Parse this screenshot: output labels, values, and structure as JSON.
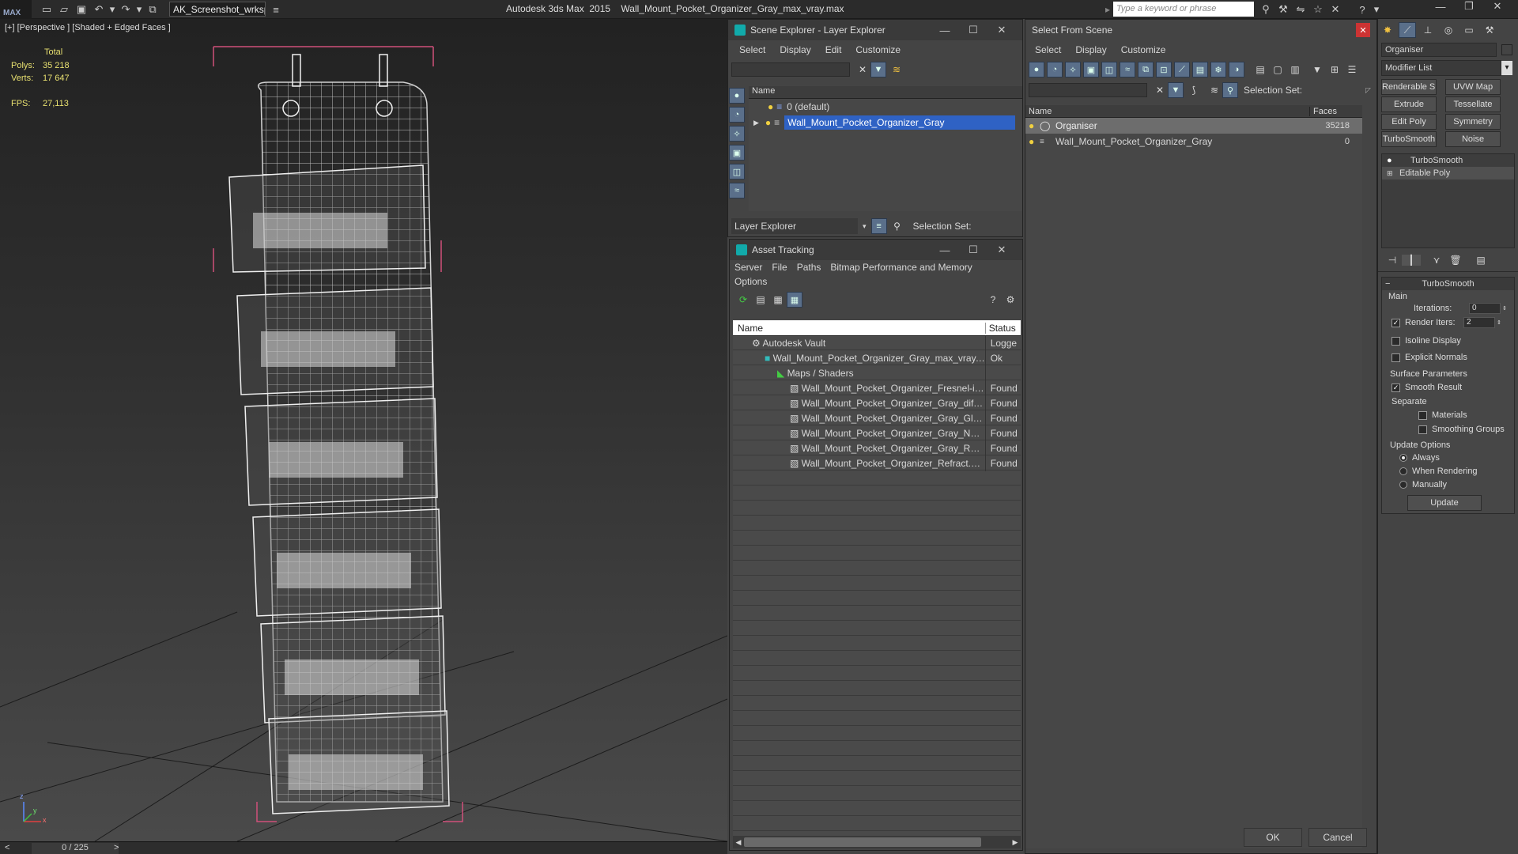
{
  "titlebar": {
    "logo": "MAX",
    "workspace": "AK_Screenshot_wrksp",
    "app_title": "Autodesk 3ds Max  2015    Wall_Mount_Pocket_Organizer_Gray_max_vray.max",
    "search_placeholder": "Type a keyword or phrase"
  },
  "viewport": {
    "label": "[+] [Perspective ] [Shaded + Edged Faces ]",
    "stats": {
      "total_label": "Total",
      "polys_label": "Polys:",
      "polys": "35 218",
      "verts_label": "Verts:",
      "verts": "17 647",
      "fps_label": "FPS:",
      "fps": "27,113"
    },
    "axis": {
      "z": "z",
      "x": "x",
      "y": "y"
    }
  },
  "timeline": {
    "frame": "0 / 225",
    "prev": "<",
    "next": ">"
  },
  "scene_explorer": {
    "title": "Scene Explorer - Layer Explorer",
    "menu": [
      "Select",
      "Display",
      "Edit",
      "Customize"
    ],
    "col_name": "Name",
    "rows": [
      {
        "label": "0 (default)",
        "selected": false
      },
      {
        "label": "Wall_Mount_Pocket_Organizer_Gray",
        "selected": true
      }
    ],
    "footer_select": "Layer Explorer",
    "footer_selset": "Selection Set:"
  },
  "asset_tracking": {
    "title": "Asset Tracking",
    "menu": [
      "Server",
      "File",
      "Paths",
      "Bitmap Performance and Memory"
    ],
    "menu2": "Options",
    "col_name": "Name",
    "col_status": "Status",
    "rows": [
      {
        "indent": 0,
        "name": "Autodesk Vault",
        "status": "Logge"
      },
      {
        "indent": 1,
        "name": "Wall_Mount_Pocket_Organizer_Gray_max_vray....",
        "status": "Ok"
      },
      {
        "indent": 2,
        "name": "Maps / Shaders",
        "status": ""
      },
      {
        "indent": 3,
        "name": "Wall_Mount_Pocket_Organizer_Fresnel-ior....",
        "status": "Found"
      },
      {
        "indent": 3,
        "name": "Wall_Mount_Pocket_Organizer_Gray_diffus...",
        "status": "Found"
      },
      {
        "indent": 3,
        "name": "Wall_Mount_Pocket_Organizer_Gray_Gloss...",
        "status": "Found"
      },
      {
        "indent": 3,
        "name": "Wall_Mount_Pocket_Organizer_Gray_Nor...",
        "status": "Found"
      },
      {
        "indent": 3,
        "name": "Wall_Mount_Pocket_Organizer_Gray_Refle...",
        "status": "Found"
      },
      {
        "indent": 3,
        "name": "Wall_Mount_Pocket_Organizer_Refract.png",
        "status": "Found"
      }
    ]
  },
  "select_from_scene": {
    "title": "Select From Scene",
    "menu": [
      "Select",
      "Display",
      "Customize"
    ],
    "selset": "Selection Set:",
    "col_name": "Name",
    "col_faces": "Faces",
    "rows": [
      {
        "name": "Organiser",
        "faces": "35218",
        "selected": true
      },
      {
        "name": "Wall_Mount_Pocket_Organizer_Gray",
        "faces": "0",
        "selected": false
      }
    ],
    "ok": "OK",
    "cancel": "Cancel"
  },
  "command_panel": {
    "object_name": "Organiser",
    "modifier_list": "Modifier List",
    "buttons": [
      "Renderable Spline",
      "UVW Map",
      "Extrude",
      "Tessellate",
      "Edit Poly",
      "Symmetry",
      "TurboSmooth",
      "Noise"
    ],
    "stack": [
      "TurboSmooth",
      "Editable Poly"
    ],
    "rollout_title": "TurboSmooth",
    "main_label": "Main",
    "iterations_label": "Iterations:",
    "iterations": "0",
    "render_iters_label": "Render Iters:",
    "render_iters": "2",
    "isoline": "Isoline Display",
    "explicit": "Explicit Normals",
    "surface_params": "Surface Parameters",
    "smooth_result": "Smooth Result",
    "separate": "Separate",
    "materials": "Materials",
    "smoothing_groups": "Smoothing Groups",
    "update_options": "Update Options",
    "always": "Always",
    "when_rendering": "When Rendering",
    "manually": "Manually",
    "update": "Update"
  }
}
